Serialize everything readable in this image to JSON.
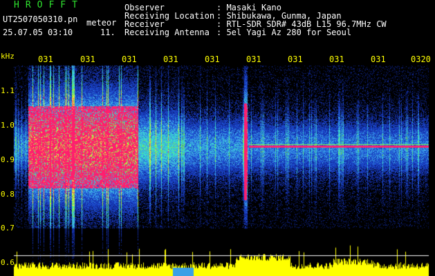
{
  "app": {
    "title": "HROFFT",
    "filename": "UT2507050310.pn",
    "tag": "meteor",
    "timestamp": "25.07.05 03:10",
    "count": "11."
  },
  "info": {
    "rows": [
      {
        "label": "Observer",
        "value": ": Masaki Kano"
      },
      {
        "label": "Receiving Location",
        "value": ": Shibukawa, Gunma, Japan"
      },
      {
        "label": "Receiver",
        "value": ": RTL-SDR SDR# 43dB L15 96.7MHz CW"
      },
      {
        "label": "Receiving Antenna",
        "value": ": 5el Yagi Az 280 for Seoul"
      }
    ]
  },
  "axes": {
    "y_unit": "kHz",
    "time_labels": [
      "031",
      "031",
      "031",
      "031",
      "031",
      "031",
      "031",
      "031",
      "031",
      "0320"
    ],
    "freq_labels": [
      "1.1",
      "1.0",
      "0.9",
      "0.8",
      "0.7",
      "0.6"
    ]
  },
  "colors": {
    "background": "#000000",
    "title": "#2fe42f",
    "text": "#ffffff",
    "axis_text": "#ffff00",
    "level_trace": "#ffff00",
    "signal_hot": "#ff1e6e",
    "noise": "#1e50d2"
  }
}
